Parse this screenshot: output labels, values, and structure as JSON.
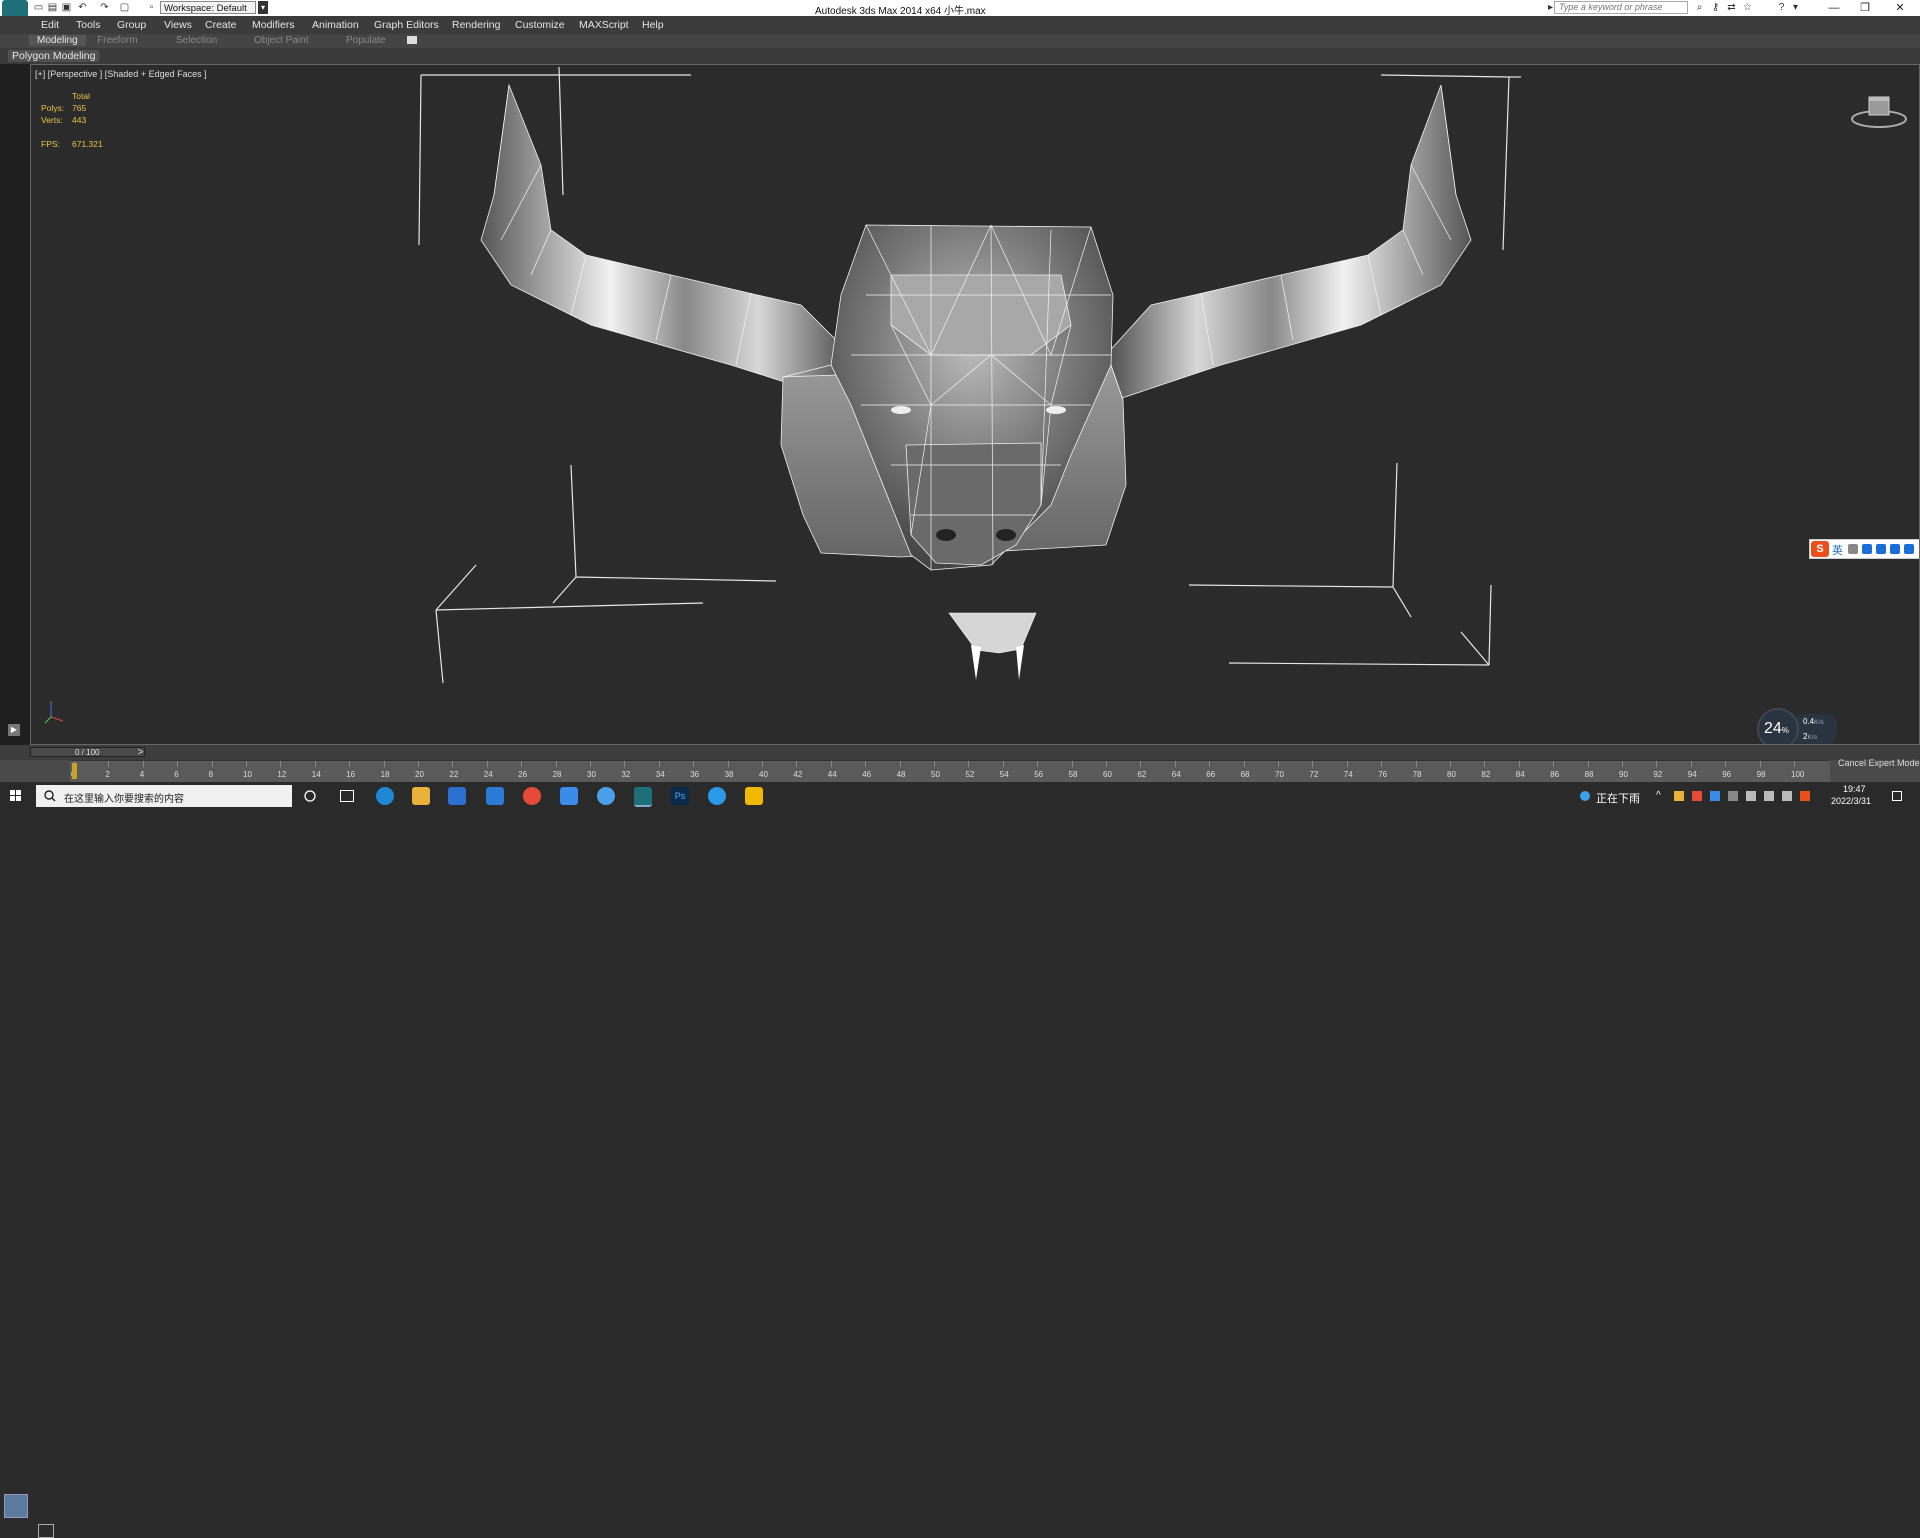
{
  "titlebar": {
    "title": "Autodesk 3ds Max  2014 x64      小牛.max",
    "workspace": "Workspace: Default",
    "search_placeholder": "Type a keyword or phrase"
  },
  "menu": [
    "Edit",
    "Tools",
    "Group",
    "Views",
    "Create",
    "Modifiers",
    "Animation",
    "Graph Editors",
    "Rendering",
    "Customize",
    "MAXScript",
    "Help"
  ],
  "ribbon": {
    "tabs": [
      "Modeling",
      "Freeform",
      "Selection",
      "Object Paint",
      "Populate"
    ],
    "panel": "Polygon Modeling"
  },
  "viewport": {
    "label": "[+] [Perspective ] [Shaded + Edged Faces ]",
    "stats": {
      "total_label": "Total",
      "polys_label": "Polys:",
      "polys_value": "765",
      "verts_label": "Verts:",
      "verts_value": "443",
      "fps_label": "FPS:",
      "fps_value": "671.321"
    }
  },
  "ime": {
    "lang": "英"
  },
  "netmon": {
    "percent": "24",
    "percent_unit": "%",
    "up": "0.4",
    "up_unit": "K/s",
    "down": "2",
    "down_unit": "K/s"
  },
  "timeline": {
    "frame": "0 / 100",
    "ticks": [
      "0",
      "2",
      "4",
      "6",
      "8",
      "10",
      "12",
      "14",
      "16",
      "18",
      "20",
      "22",
      "24",
      "26",
      "28",
      "30",
      "32",
      "34",
      "36",
      "38",
      "40",
      "42",
      "44",
      "46",
      "48",
      "50",
      "52",
      "54",
      "56",
      "58",
      "60",
      "62",
      "64",
      "66",
      "68",
      "70",
      "72",
      "74",
      "76",
      "78",
      "80",
      "82",
      "84",
      "86",
      "88",
      "90",
      "92",
      "94",
      "96",
      "98",
      "100"
    ],
    "cancel_expert": "Cancel Expert Mode"
  },
  "taskbar": {
    "search": "在这里输入你要搜索的内容",
    "weather": "正在下雨",
    "time": "19:47",
    "date": "2022/3/31"
  },
  "colors": {
    "title_bg": "#ffffff",
    "menu_bg": "#3b3b3b",
    "viewport_bg": "#2b2b2b",
    "stats_color": "#e8c34a",
    "ime_brand": "#e94e1b",
    "taskbar_bg": "#2a2a2a"
  },
  "icons": [
    "app-icon",
    "new-file-icon",
    "open-icon",
    "save-icon",
    "undo-icon",
    "redo-icon",
    "search-icon",
    "key-icon",
    "star-icon",
    "help-icon",
    "minimize-icon",
    "restore-icon",
    "close-icon",
    "viewcube-icon",
    "windows-logo-icon",
    "cortana-icon",
    "task-view-icon"
  ]
}
